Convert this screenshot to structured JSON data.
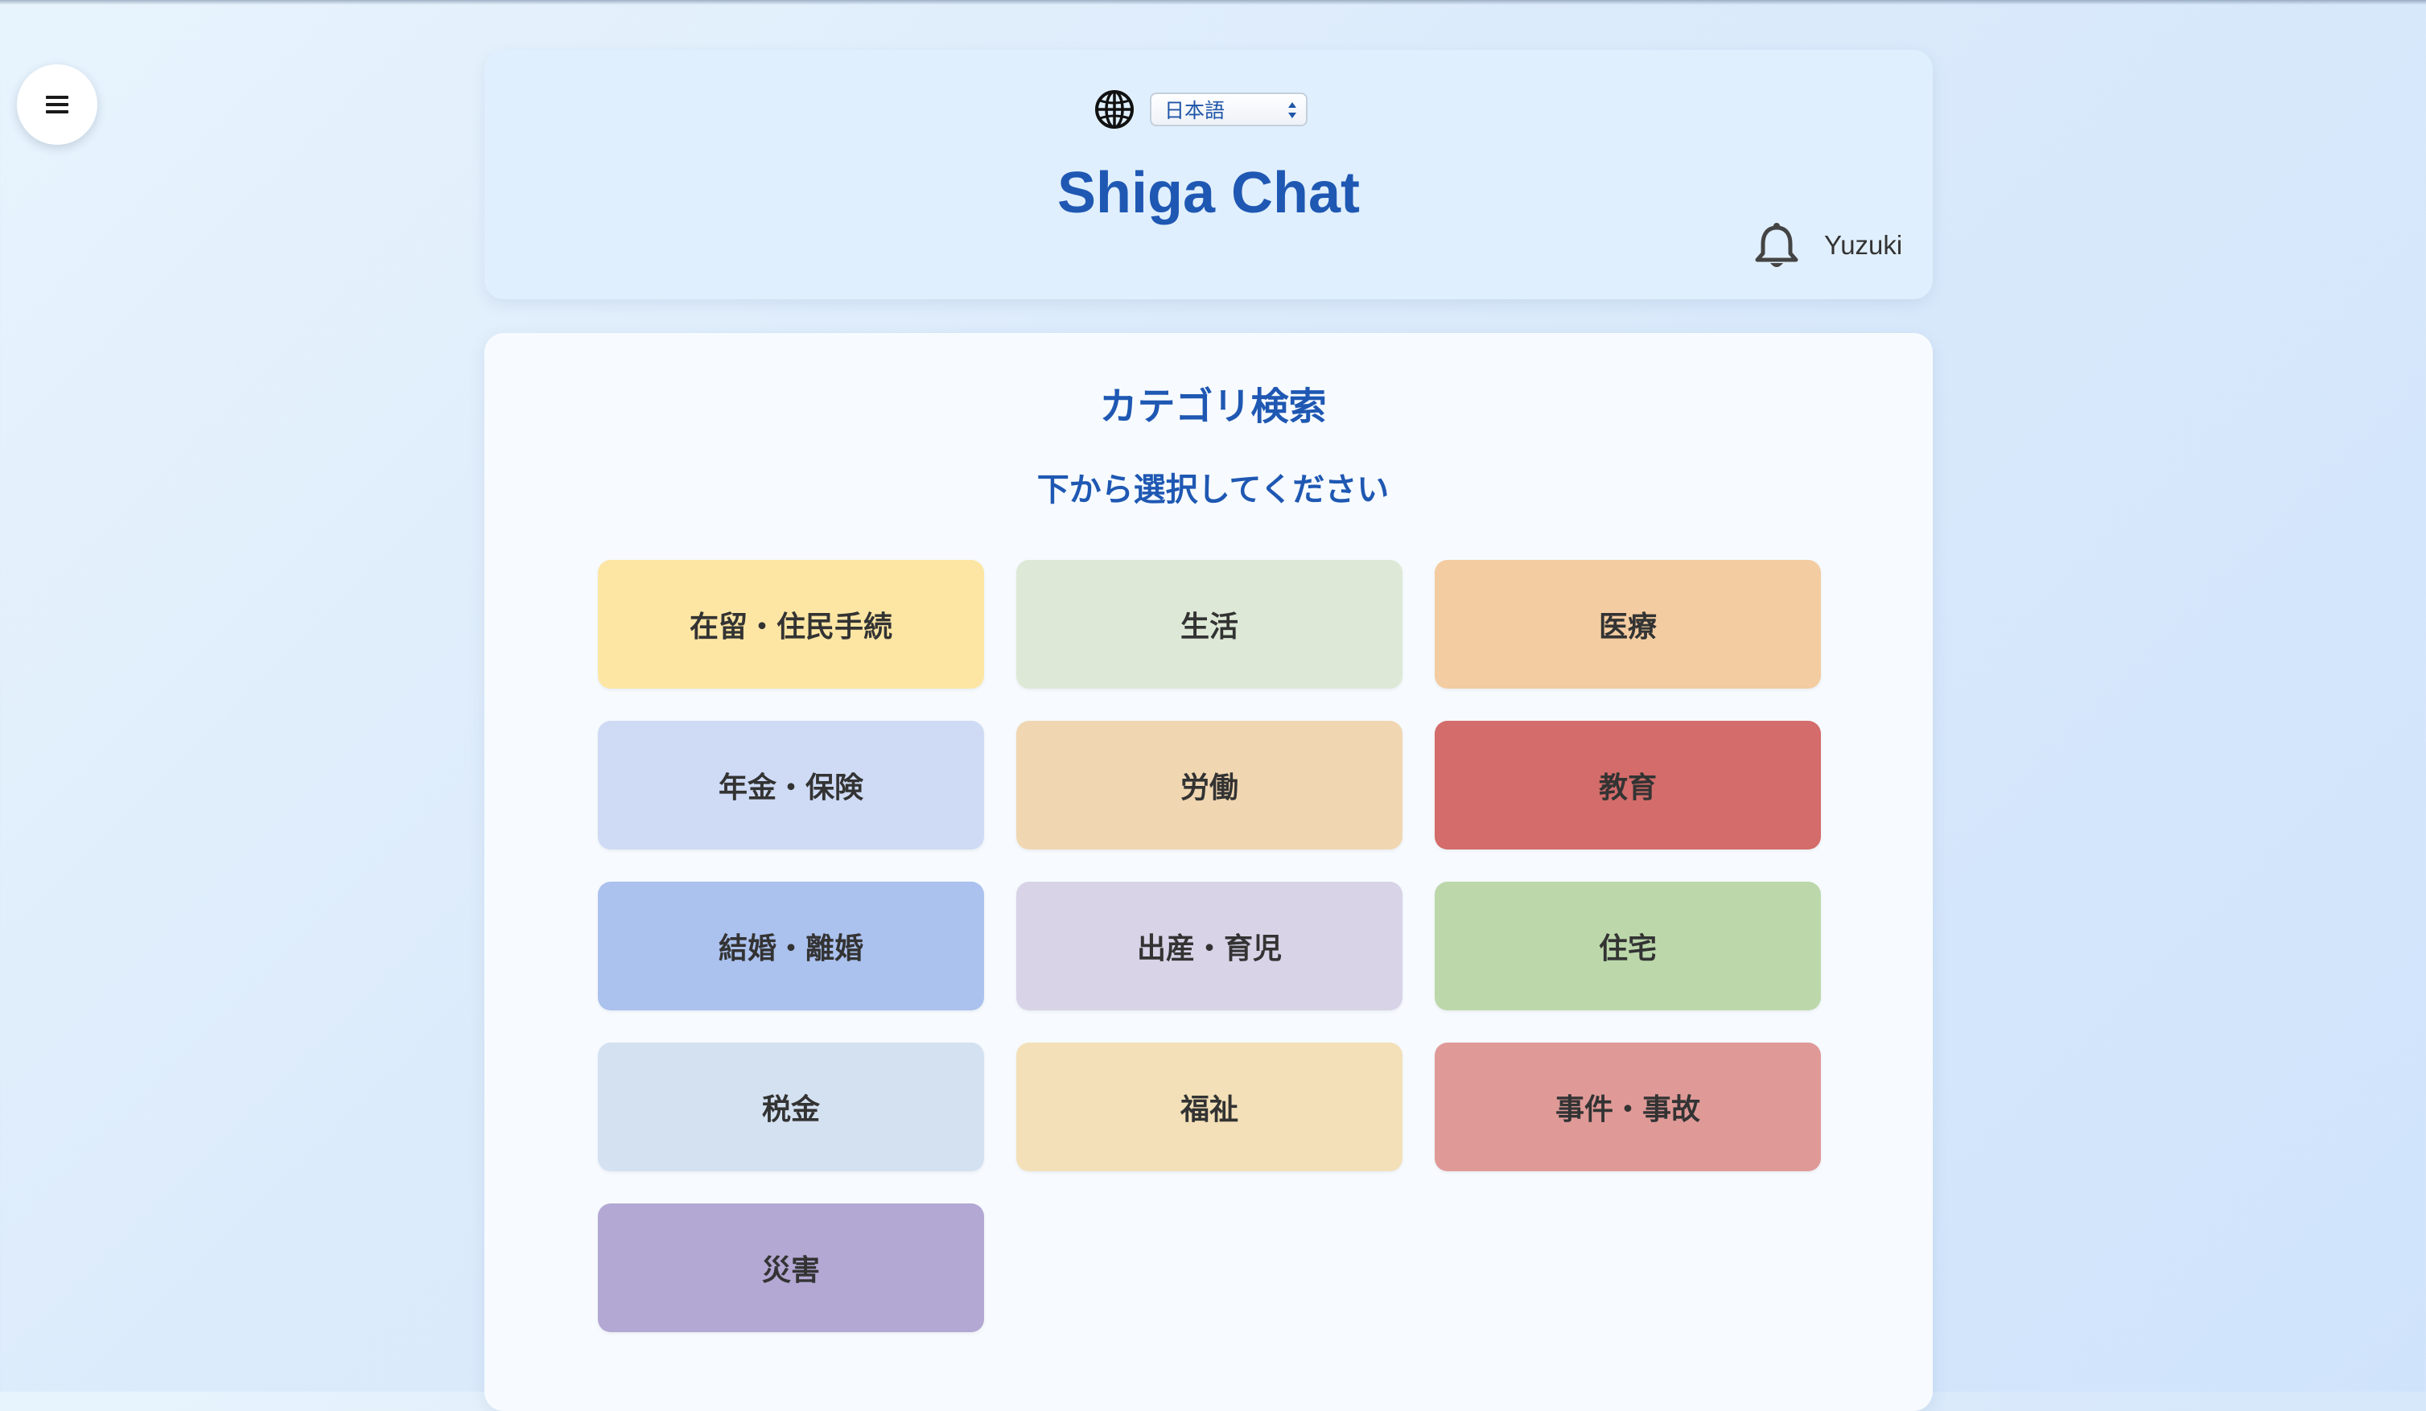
{
  "language_select": {
    "value": "日本語"
  },
  "header": {
    "title": "Shiga Chat",
    "username": "Yuzuki"
  },
  "category_search": {
    "title": "カテゴリ検索",
    "subtitle": "下から選択してください",
    "categories": [
      {
        "label": "在留・住民手続",
        "color": "#fde6a4"
      },
      {
        "label": "生活",
        "color": "#dde9d6"
      },
      {
        "label": "医療",
        "color": "#f3cca1"
      },
      {
        "label": "年金・保険",
        "color": "#cfdbf5"
      },
      {
        "label": "労働",
        "color": "#f0d7b2"
      },
      {
        "label": "教育",
        "color": "#d36c6a"
      },
      {
        "label": "結婚・離婚",
        "color": "#abc1ee"
      },
      {
        "label": "出産・育児",
        "color": "#d8d3e7"
      },
      {
        "label": "住宅",
        "color": "#bcd8ab"
      },
      {
        "label": "税金",
        "color": "#d4e1f1"
      },
      {
        "label": "福祉",
        "color": "#f3e0b8"
      },
      {
        "label": "事件・事故",
        "color": "#df9a98"
      },
      {
        "label": "災害",
        "color": "#b3a7d3"
      }
    ]
  },
  "icons": [
    "menu-icon",
    "globe-icon",
    "bell-icon",
    "select-arrows-icon"
  ],
  "colors": {
    "accent": "#1f58b3",
    "header_bg": "#e0effd",
    "card_bg": "#f7fbff"
  }
}
